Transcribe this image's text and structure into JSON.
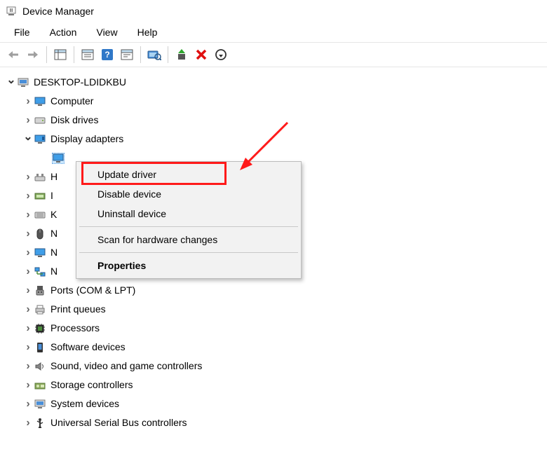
{
  "window": {
    "title": "Device Manager"
  },
  "menubar": {
    "file": "File",
    "action": "Action",
    "view": "View",
    "help": "Help"
  },
  "tree": {
    "root": "DESKTOP-LDIDKBU",
    "items": [
      {
        "label": "Computer"
      },
      {
        "label": "Disk drives"
      },
      {
        "label": "Display adapters",
        "expanded": true
      },
      {
        "label": "H"
      },
      {
        "label": "I"
      },
      {
        "label": "K"
      },
      {
        "label": "N"
      },
      {
        "label": "N"
      },
      {
        "label": "N"
      },
      {
        "label": "Ports (COM & LPT)"
      },
      {
        "label": "Print queues"
      },
      {
        "label": "Processors"
      },
      {
        "label": "Software devices"
      },
      {
        "label": "Sound, video and game controllers"
      },
      {
        "label": "Storage controllers"
      },
      {
        "label": "System devices"
      },
      {
        "label": "Universal Serial Bus controllers"
      }
    ]
  },
  "context_menu": {
    "update": "Update driver",
    "disable": "Disable device",
    "uninstall": "Uninstall device",
    "scan": "Scan for hardware changes",
    "properties": "Properties"
  }
}
